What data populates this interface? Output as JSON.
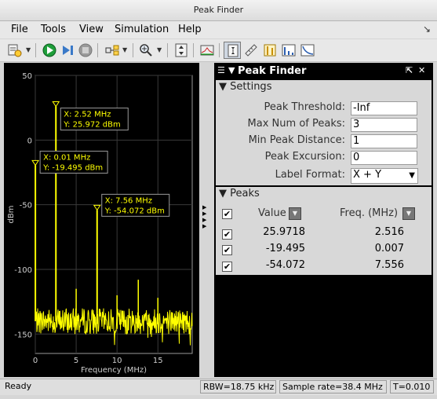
{
  "window": {
    "title": "Peak Finder"
  },
  "menu": [
    {
      "label": "File"
    },
    {
      "label": "Tools"
    },
    {
      "label": "View"
    },
    {
      "label": "Simulation"
    },
    {
      "label": "Help"
    }
  ],
  "toolbar_icons": [
    "config-icon",
    "run-icon",
    "step-icon",
    "stop-icon",
    "highlight-icon",
    "zoom-icon",
    "scale-icon",
    "spectrum-icon",
    "cursor-icon",
    "measure-icon",
    "peaks-icon",
    "distortion-icon",
    "ccdf-icon"
  ],
  "plot": {
    "ylabel": "dBm",
    "xlabel": "Frequency (MHz)",
    "yticks": [
      "50",
      "0",
      "-50",
      "-100",
      "-150"
    ],
    "xticks": [
      "0",
      "5",
      "10",
      "15"
    ],
    "trace_color": "#ffff00",
    "annotations": [
      {
        "x_label": "X: 2.52 MHz",
        "y_label": "Y: 25.972 dBm"
      },
      {
        "x_label": "X: 0.01 MHz",
        "y_label": "Y: -19.495 dBm"
      },
      {
        "x_label": "X: 7.56 MHz",
        "y_label": "Y: -54.072 dBm"
      }
    ]
  },
  "chart_data": {
    "type": "line",
    "xlabel": "Frequency (MHz)",
    "ylabel": "dBm",
    "xlim": [
      0,
      19.2
    ],
    "ylim": [
      -165,
      50
    ],
    "peaks": [
      {
        "x": 2.52,
        "y": 25.972
      },
      {
        "x": 0.01,
        "y": -19.495
      },
      {
        "x": 7.56,
        "y": -54.072
      }
    ],
    "spurs": [
      {
        "x": 5.0,
        "y": -115
      },
      {
        "x": 10.0,
        "y": -120
      },
      {
        "x": 12.6,
        "y": -108
      },
      {
        "x": 15.0,
        "y": -122
      }
    ],
    "noise_floor": -140,
    "grid": true
  },
  "peak_finder": {
    "title": "Peak Finder",
    "settings_header": "Settings",
    "settings": [
      {
        "label": "Peak Threshold:",
        "value": "-Inf"
      },
      {
        "label": "Max Num of Peaks:",
        "value": "3"
      },
      {
        "label": "Min Peak Distance:",
        "value": "1"
      },
      {
        "label": "Peak Excursion:",
        "value": "0"
      }
    ],
    "label_format": {
      "label": "Label Format:",
      "value": "X + Y"
    },
    "peaks_header": "Peaks",
    "columns": {
      "value": "Value",
      "freq": "Freq. (MHz)"
    },
    "rows": [
      {
        "value": "25.9718",
        "freq": "2.516",
        "checked": true
      },
      {
        "value": "-19.495",
        "freq": "0.007",
        "checked": true
      },
      {
        "value": "-54.072",
        "freq": "7.556",
        "checked": true
      }
    ]
  },
  "status": {
    "ready": "Ready",
    "rbw": "RBW=18.75 kHz",
    "sample_rate": "Sample rate=38.4 MHz",
    "time": "T=0.010"
  }
}
